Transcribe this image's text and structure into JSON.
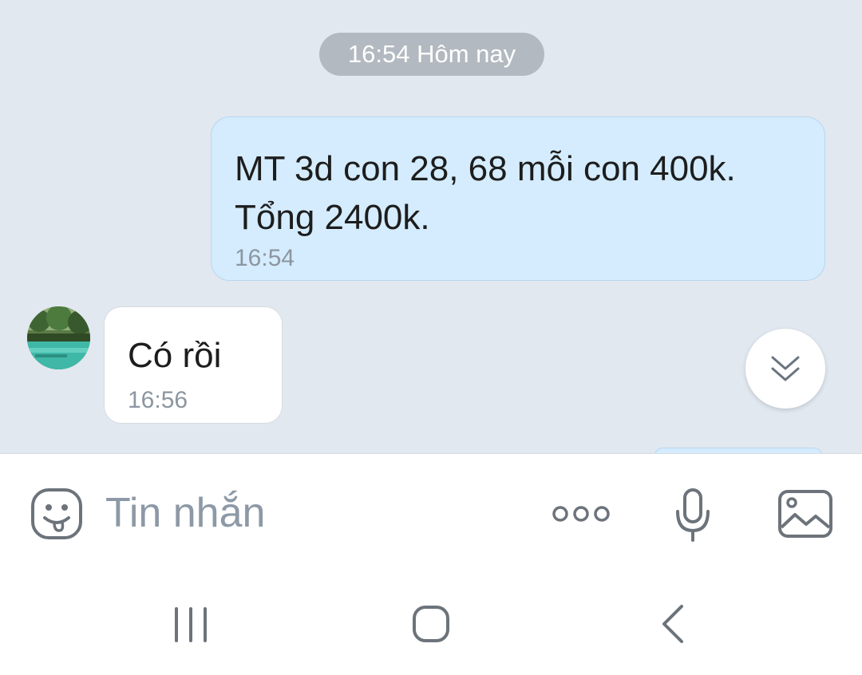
{
  "chat": {
    "date_separator": "16:54 Hôm nay",
    "messages": [
      {
        "direction": "outgoing",
        "text": "MT 3d con 28, 68 mỗi con 400k.\nTổng 2400k.",
        "time": "16:54"
      },
      {
        "direction": "incoming",
        "text": "Có rồi",
        "time": "16:56"
      }
    ]
  },
  "composer": {
    "placeholder": "Tin nhắn",
    "icons": [
      "emoji-sticker-icon",
      "more-options-icon",
      "microphone-icon",
      "image-gallery-icon"
    ]
  },
  "scroll_button": {
    "icon": "chevrons-down-icon"
  },
  "system_nav": {
    "icons": [
      "recent-apps-icon",
      "home-icon",
      "back-icon"
    ]
  },
  "colors": {
    "chat_background": "#e2e8f0",
    "outgoing_bubble": "#d4ecfd",
    "incoming_bubble": "#ffffff",
    "date_pill": "#b3b9c0",
    "placeholder_text": "#8d99a6"
  }
}
